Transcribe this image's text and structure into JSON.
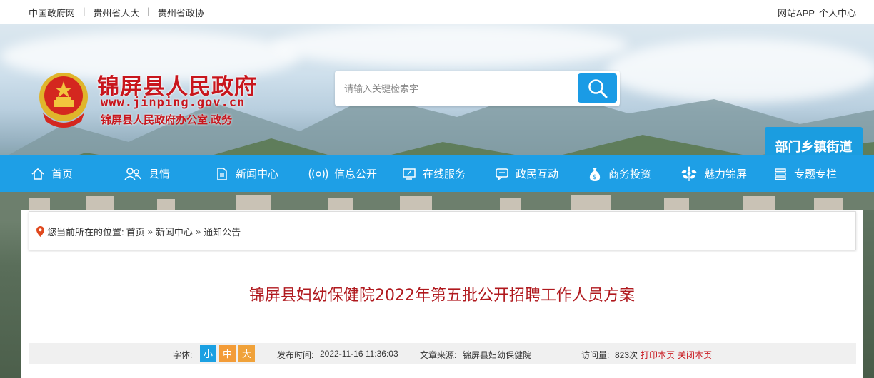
{
  "topbar": {
    "links": [
      "中国政府网",
      "贵州省人大",
      "贵州省政协"
    ],
    "separator": "|",
    "right_links": [
      "网站APP",
      "个人中心"
    ]
  },
  "header": {
    "site_title": "锦屏县人民政府",
    "domain": "www.jinping.gov.cn",
    "subtitle": "锦屏县人民政府办公室.政务",
    "search_placeholder": "请输入关键检索字",
    "dept_button": "部门乡镇街道"
  },
  "nav": {
    "items": [
      {
        "label": "首页",
        "icon": "home-icon"
      },
      {
        "label": "县情",
        "icon": "people-icon"
      },
      {
        "label": "新闻中心",
        "icon": "document-icon"
      },
      {
        "label": "信息公开",
        "icon": "broadcast-icon"
      },
      {
        "label": "在线服务",
        "icon": "monitor-icon"
      },
      {
        "label": "政民互动",
        "icon": "chat-icon"
      },
      {
        "label": "商务投资",
        "icon": "money-bag-icon"
      },
      {
        "label": "魅力锦屏",
        "icon": "flower-icon"
      },
      {
        "label": "专题专栏",
        "icon": "stack-icon"
      }
    ]
  },
  "breadcrumb": {
    "prefix": "您当前所在的位置:",
    "items": [
      "首页",
      "新闻中心",
      "通知公告"
    ],
    "arrow": "»"
  },
  "article": {
    "title": "锦屏县妇幼保健院2022年第五批公开招聘工作人员方案",
    "font_label": "字体:",
    "font_sizes": [
      "小",
      "中",
      "大"
    ],
    "publish_label": "发布时间:",
    "publish_time": "2022-11-16 11:36:03",
    "source_label": "文章来源:",
    "source": "锦屏县妇幼保健院",
    "visits_label": "访问量:",
    "visits": "823次",
    "print": "打印本页",
    "close": "关闭本页"
  },
  "colors": {
    "brand_red": "#c8161d",
    "nav_blue": "#1e9fe6",
    "font_small": "#1ba0e2",
    "font_medium": "#f39c38",
    "font_large": "#f0a23a"
  }
}
